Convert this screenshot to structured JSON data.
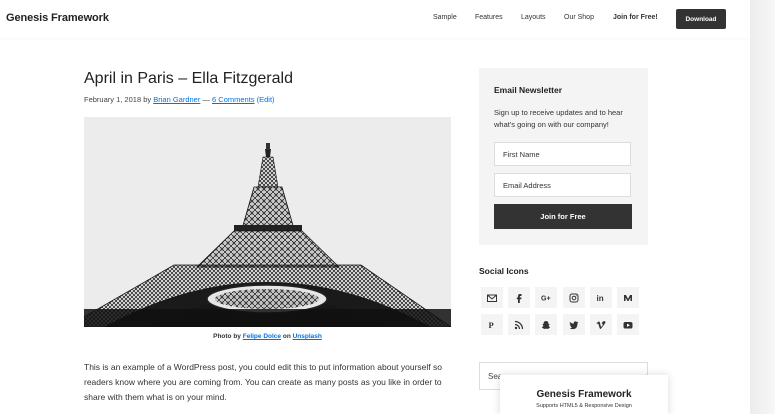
{
  "header": {
    "site_title": "Genesis Framework",
    "nav": [
      {
        "label": "Sample"
      },
      {
        "label": "Features"
      },
      {
        "label": "Layouts"
      },
      {
        "label": "Our Shop"
      },
      {
        "label": "Join for Free!"
      }
    ],
    "download_label": "Download"
  },
  "post": {
    "title": "April in Paris – Ella Fitzgerald",
    "date": "February 1, 2018",
    "by": "by",
    "author": "Brian Gardner",
    "separator": "—",
    "comments": "6 Comments",
    "edit": "(Edit)",
    "caption_prefix": "Photo by",
    "caption_author": "Felipe Dolce",
    "caption_on": "on",
    "caption_site": "Unsplash",
    "body": "This is an example of a WordPress post, you could edit this to put information about yourself so readers know where you are coming from. You can create as many posts as you like in order to share with them what is on your mind."
  },
  "newsletter": {
    "title": "Email Newsletter",
    "text": "Sign up to receive updates and to hear what's going on with our company!",
    "first_name_placeholder": "First Name",
    "email_placeholder": "Email Address",
    "button": "Join for Free"
  },
  "social": {
    "title": "Social Icons",
    "icons": [
      "email-icon",
      "facebook-icon",
      "google-plus-icon",
      "instagram-icon",
      "linkedin-icon",
      "medium-icon",
      "pinterest-icon",
      "rss-icon",
      "snapchat-icon",
      "twitter-icon",
      "vimeo-icon",
      "youtube-icon"
    ]
  },
  "search": {
    "placeholder": "Sea"
  },
  "promo": {
    "title": "Genesis Framework",
    "subtitle": "Supports HTML5 & Responsive Design"
  }
}
